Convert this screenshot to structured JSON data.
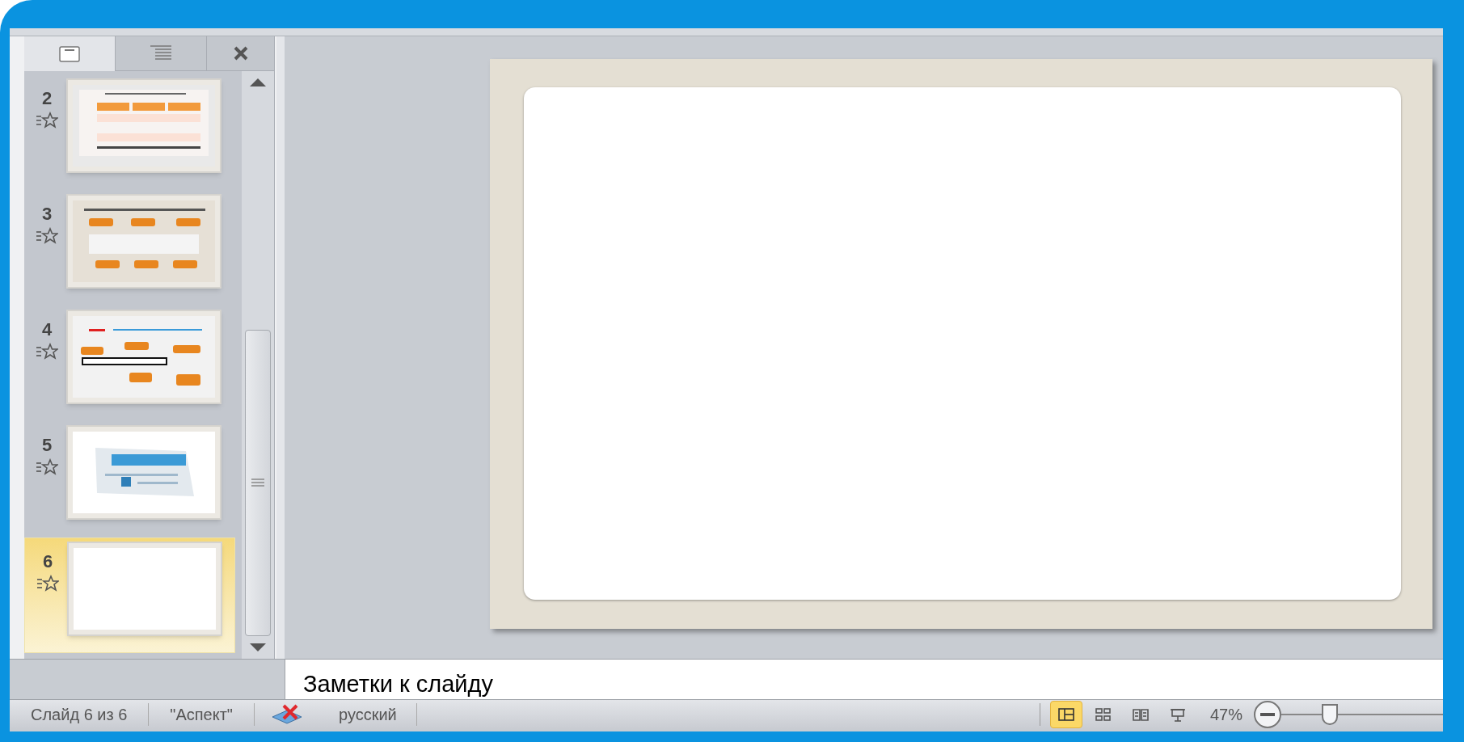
{
  "panel_tabs": [
    {
      "kind": "slides",
      "selected": true
    },
    {
      "kind": "outline",
      "selected": false
    }
  ],
  "slides": [
    {
      "number": "2",
      "kind": "table",
      "selected": false
    },
    {
      "number": "3",
      "kind": "callouts",
      "selected": false
    },
    {
      "number": "4",
      "kind": "diagram",
      "selected": false
    },
    {
      "number": "5",
      "kind": "screenshot",
      "selected": false
    },
    {
      "number": "6",
      "kind": "blank",
      "selected": true
    }
  ],
  "notes": {
    "placeholder": "Заметки к слайду"
  },
  "status_bar": {
    "slide_info": "Слайд 6 из 6",
    "theme": "\"Аспект\"",
    "language": "русский",
    "views": [
      {
        "kind": "normal",
        "selected": true
      },
      {
        "kind": "sorter",
        "selected": false
      },
      {
        "kind": "reading",
        "selected": false
      },
      {
        "kind": "slideshow",
        "selected": false
      }
    ],
    "zoom": "47%",
    "zoom_slider": {
      "level": 0.3
    }
  }
}
